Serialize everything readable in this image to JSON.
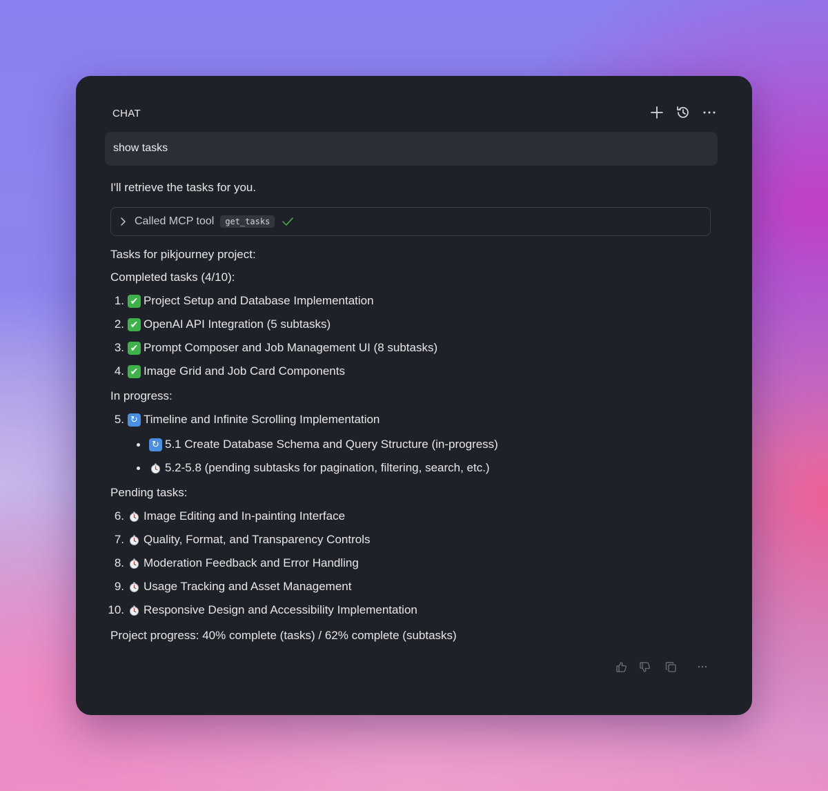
{
  "header": {
    "title": "CHAT",
    "actions": [
      {
        "icon": "plus-icon",
        "name": "new-chat-button"
      },
      {
        "icon": "history-icon",
        "name": "history-button"
      },
      {
        "icon": "more-horizontal-icon",
        "name": "more-options-button"
      }
    ]
  },
  "user_message": "show tasks",
  "assistant": {
    "intro": "I'll retrieve the tasks for you.",
    "tool_call": {
      "label": "Called MCP tool",
      "tool_name": "get_tasks",
      "status": "success"
    },
    "project_heading": "Tasks for pikjourney project:",
    "completed_heading": "Completed tasks (4/10):",
    "completed": [
      {
        "num": "1.",
        "icon": "check-emoji",
        "text": "Project Setup and Database Implementation"
      },
      {
        "num": "2.",
        "icon": "check-emoji",
        "text": "OpenAI API Integration (5 subtasks)"
      },
      {
        "num": "3.",
        "icon": "check-emoji",
        "text": "Prompt Composer and Job Management UI (8 subtasks)"
      },
      {
        "num": "4.",
        "icon": "check-emoji",
        "text": "Image Grid and Job Card Components"
      }
    ],
    "in_progress_heading": "In progress:",
    "in_progress": [
      {
        "num": "5.",
        "icon": "cycle-emoji",
        "text": "Timeline and Infinite Scrolling Implementation"
      }
    ],
    "in_progress_subtasks": [
      {
        "icon": "cycle-emoji",
        "text": "5.1 Create Database Schema and Query Structure (in-progress)"
      },
      {
        "icon": "timer-emoji",
        "text": "5.2-5.8 (pending subtasks for pagination, filtering, search, etc.)"
      }
    ],
    "pending_heading": "Pending tasks:",
    "pending": [
      {
        "num": "6.",
        "icon": "timer-emoji",
        "text": "Image Editing and In-painting Interface"
      },
      {
        "num": "7.",
        "icon": "timer-emoji",
        "text": "Quality, Format, and Transparency Controls"
      },
      {
        "num": "8.",
        "icon": "timer-emoji",
        "text": "Moderation Feedback and Error Handling"
      },
      {
        "num": "9.",
        "icon": "timer-emoji",
        "text": "Usage Tracking and Asset Management"
      },
      {
        "num": "10.",
        "icon": "timer-emoji",
        "text": "Responsive Design and Accessibility Implementation"
      }
    ],
    "progress_summary": "Project progress: 40% complete (tasks) / 62% complete (subtasks)"
  },
  "footer_actions": [
    {
      "icon": "thumbs-up-icon",
      "name": "thumbs-up-button"
    },
    {
      "icon": "thumbs-down-icon",
      "name": "thumbs-down-button"
    },
    {
      "icon": "copy-icon",
      "name": "copy-button"
    },
    {
      "icon": "more-horizontal-icon",
      "name": "message-more-button"
    }
  ],
  "colors": {
    "panel_bg": "#1f2128",
    "user_bubble_bg": "#2b2e37",
    "check_green": "#3fb14a",
    "cycle_blue": "#4a8fe0",
    "success_check": "#4caf50"
  }
}
